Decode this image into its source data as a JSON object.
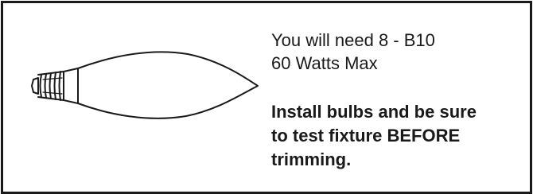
{
  "bulb": {
    "icon": "candelabra-bulb-icon"
  },
  "requirements": {
    "line1": "You will need 8 - B10",
    "line2": "60 Watts Max"
  },
  "instructions": {
    "line1": "Install bulbs and be sure",
    "line2": "to test fixture BEFORE",
    "line3": "trimming."
  }
}
